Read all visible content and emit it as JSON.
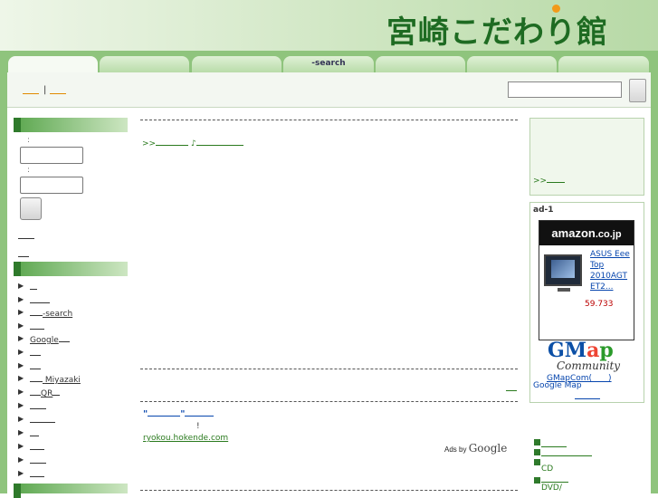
{
  "header": {
    "logo_text": "宮崎こだわり館"
  },
  "tabs": [
    {
      "label": ""
    },
    {
      "label": ""
    },
    {
      "label": ""
    },
    {
      "label": "-search"
    },
    {
      "label": ""
    },
    {
      "label": ""
    },
    {
      "label": ""
    }
  ],
  "toolbar": {
    "separator": "|",
    "search_placeholder": ""
  },
  "login": {
    "colon_1": ":",
    "colon_2": ":"
  },
  "left_nav": {
    "items": [
      {
        "label": ""
      },
      {
        "label": ""
      },
      {
        "label": "-search"
      },
      {
        "label": ""
      },
      {
        "label": "Google"
      },
      {
        "label": ""
      },
      {
        "label": ""
      },
      {
        "label": "Miyazaki"
      },
      {
        "label": "QR"
      },
      {
        "label": ""
      },
      {
        "label": ""
      },
      {
        "label": ""
      },
      {
        "label": ""
      },
      {
        "label": ""
      },
      {
        "label": ""
      }
    ]
  },
  "main": {
    "intro_link_prefix": ">>",
    "intro_link_note": "♪",
    "ad_link_title_quotes": "\"",
    "ad_text_exclaim": "!",
    "ad_url": "ryokou.hokende.com",
    "ads_by": "Ads by",
    "ads_google": "Google",
    "more_link": ">>"
  },
  "right": {
    "more_link": ">>",
    "ad_label": "ad-1",
    "amazon_text": "amazon",
    "amazon_domain": ".co.jp",
    "product_name": "ASUS Eee Top 2010AGT ET2...",
    "price": "59.733",
    "gmap_g": "GM",
    "gmap_a": "a",
    "gmap_p": "p",
    "gmap_community": "Community",
    "gmap_link": "GMapCom(　　)",
    "gmap_google": "Google Map",
    "cd_label": "CD",
    "dvd_label": "DVD/"
  },
  "colors": {
    "header_green": "#8fc47d",
    "logo_green": "#1e6b22",
    "link_green": "#2a7a1e",
    "accent_orange": "#f29a1a"
  }
}
